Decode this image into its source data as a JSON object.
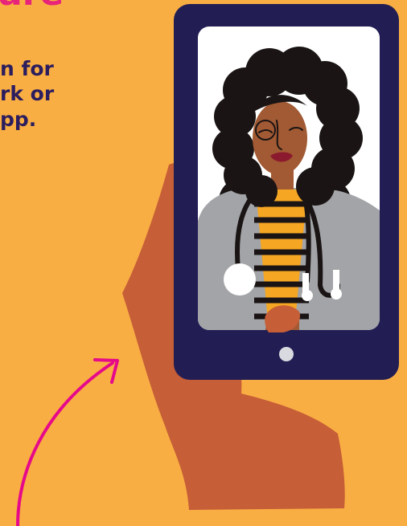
{
  "headline": "are",
  "body_lines": [
    "n for",
    "rk or",
    "pp."
  ],
  "colors": {
    "background": "#F9AE43",
    "headline": "#E8237A",
    "body_text": "#2C1E5E",
    "phone_frame": "#221E54",
    "screen_bg": "#FFFFFF",
    "hand": "#C65E37",
    "arrow": "#E60A8A",
    "skin": "#A15A33",
    "hair": "#1A1414",
    "coat": "#A2A4A7",
    "stripe_yellow": "#F5A623",
    "stripe_black": "#1A1414",
    "lips": "#8C1A2E"
  },
  "icons": {
    "arrow": "curved-arrow-icon",
    "home_button": "home-button-icon"
  }
}
